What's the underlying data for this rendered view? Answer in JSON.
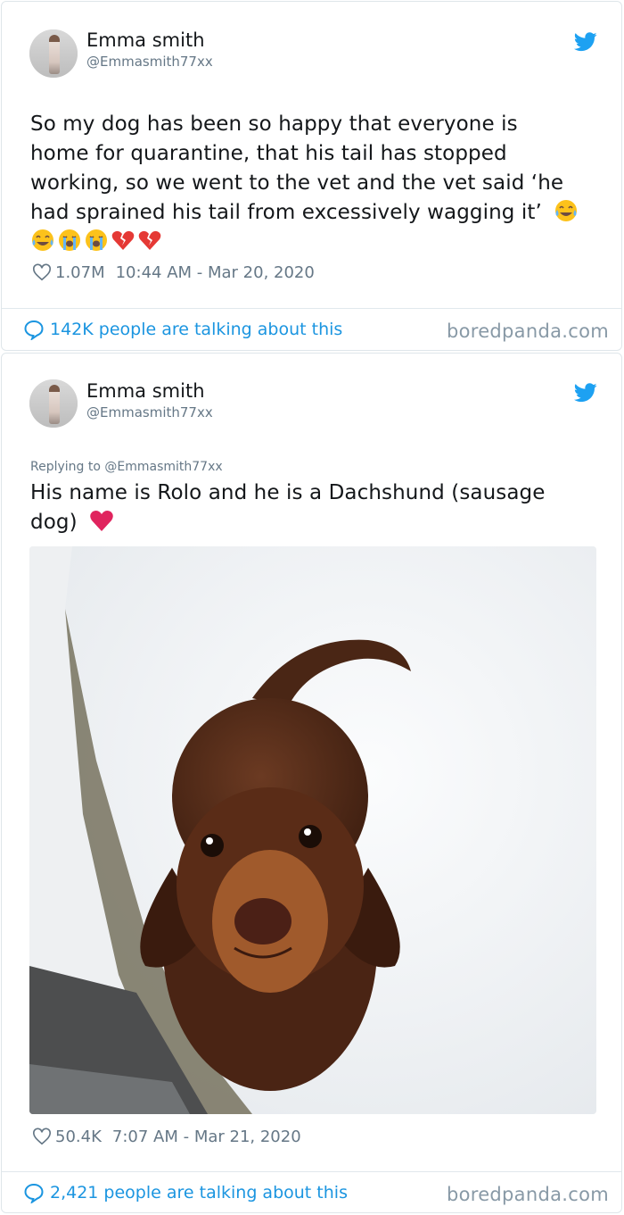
{
  "tweets": [
    {
      "author_name": "Emma smith",
      "author_handle": "@Emmasmith77xx",
      "text_lines": [
        "So my dog has been so happy that everyone is",
        "home for quarantine, that his tail has stopped",
        "working, so we went to the vet and the vet said ‘he",
        "had sprained his tail from excessively wagging it’"
      ],
      "likes": "1.07M",
      "timestamp": "10:44 AM - Mar 20, 2020",
      "talking": "142K people are talking about this",
      "source": "boredpanda.com"
    },
    {
      "author_name": "Emma smith",
      "author_handle": "@Emmasmith77xx",
      "replying_to": "Replying to @Emmasmith77xx",
      "text_line1": "His name is Rolo and he is a Dachshund (sausage",
      "text_line2": "dog)",
      "likes": "50.4K",
      "timestamp": "7:07 AM - Mar 21, 2020",
      "talking": "2,421 people are talking about this",
      "source": "boredpanda.com"
    }
  ],
  "icons": {
    "brand": "twitter-bird-icon",
    "like": "heart-outline-icon",
    "reply": "speech-bubble-icon"
  },
  "colors": {
    "link": "#1b95e0",
    "twitter_blue": "#1da1f2",
    "meta_gray": "#657786",
    "heart_red": "#e0245e"
  }
}
